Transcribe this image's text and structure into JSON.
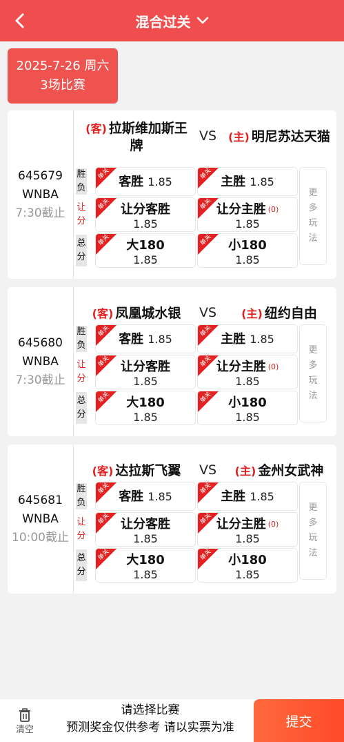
{
  "header": {
    "title": "混合过关"
  },
  "date_chip": {
    "line1": "2025-7-26 周六",
    "line2": "3场比赛"
  },
  "row_labels": {
    "winlose": "胜负",
    "handicap": "让分",
    "total": "总分"
  },
  "corner_text": "单关",
  "more_label": "更多玩法",
  "matches": [
    {
      "id": "645679",
      "league": "WNBA",
      "deadline": "7:30截止",
      "away_tag": "(客)",
      "away": "拉斯维加斯王牌",
      "vs": "VS",
      "home_tag": "(主)",
      "home": "明尼苏达天猫",
      "away_win": {
        "label": "客胜",
        "odds": "1.85"
      },
      "home_win": {
        "label": "主胜",
        "odds": "1.85"
      },
      "hc_away": {
        "label": "让分客胜",
        "odds": "1.85"
      },
      "hc_home": {
        "label": "让分主胜",
        "line": "(0)",
        "odds": "1.85"
      },
      "big": {
        "label": "大180",
        "odds": "1.85"
      },
      "small": {
        "label": "小180",
        "odds": "1.85"
      }
    },
    {
      "id": "645680",
      "league": "WNBA",
      "deadline": "7:30截止",
      "away_tag": "(客)",
      "away": "凤凰城水银",
      "vs": "VS",
      "home_tag": "(主)",
      "home": "纽约自由",
      "away_win": {
        "label": "客胜",
        "odds": "1.85"
      },
      "home_win": {
        "label": "主胜",
        "odds": "1.85"
      },
      "hc_away": {
        "label": "让分客胜",
        "odds": "1.85"
      },
      "hc_home": {
        "label": "让分主胜",
        "line": "(0)",
        "odds": "1.85"
      },
      "big": {
        "label": "大180",
        "odds": "1.85"
      },
      "small": {
        "label": "小180",
        "odds": "1.85"
      }
    },
    {
      "id": "645681",
      "league": "WNBA",
      "deadline": "10:00截止",
      "away_tag": "(客)",
      "away": "达拉斯飞翼",
      "vs": "VS",
      "home_tag": "(主)",
      "home": "金州女武神",
      "away_win": {
        "label": "客胜",
        "odds": "1.85"
      },
      "home_win": {
        "label": "主胜",
        "odds": "1.85"
      },
      "hc_away": {
        "label": "让分客胜",
        "odds": "1.85"
      },
      "hc_home": {
        "label": "让分主胜",
        "line": "(0)",
        "odds": "1.85"
      },
      "big": {
        "label": "大180",
        "odds": "1.85"
      },
      "small": {
        "label": "小180",
        "odds": "1.85"
      }
    }
  ],
  "footer": {
    "clear_label": "清空",
    "line1": "请选择比赛",
    "line2": "预测奖金仅供参考 请以实票为准",
    "submit_label": "提交"
  },
  "colors": {
    "brand": "#f04e4e",
    "accent_red": "#e02020",
    "submit": "#ff5a30"
  },
  "icons": {
    "back": "chevron-left-icon",
    "dropdown": "chevron-down-icon",
    "clear": "trash-icon"
  }
}
